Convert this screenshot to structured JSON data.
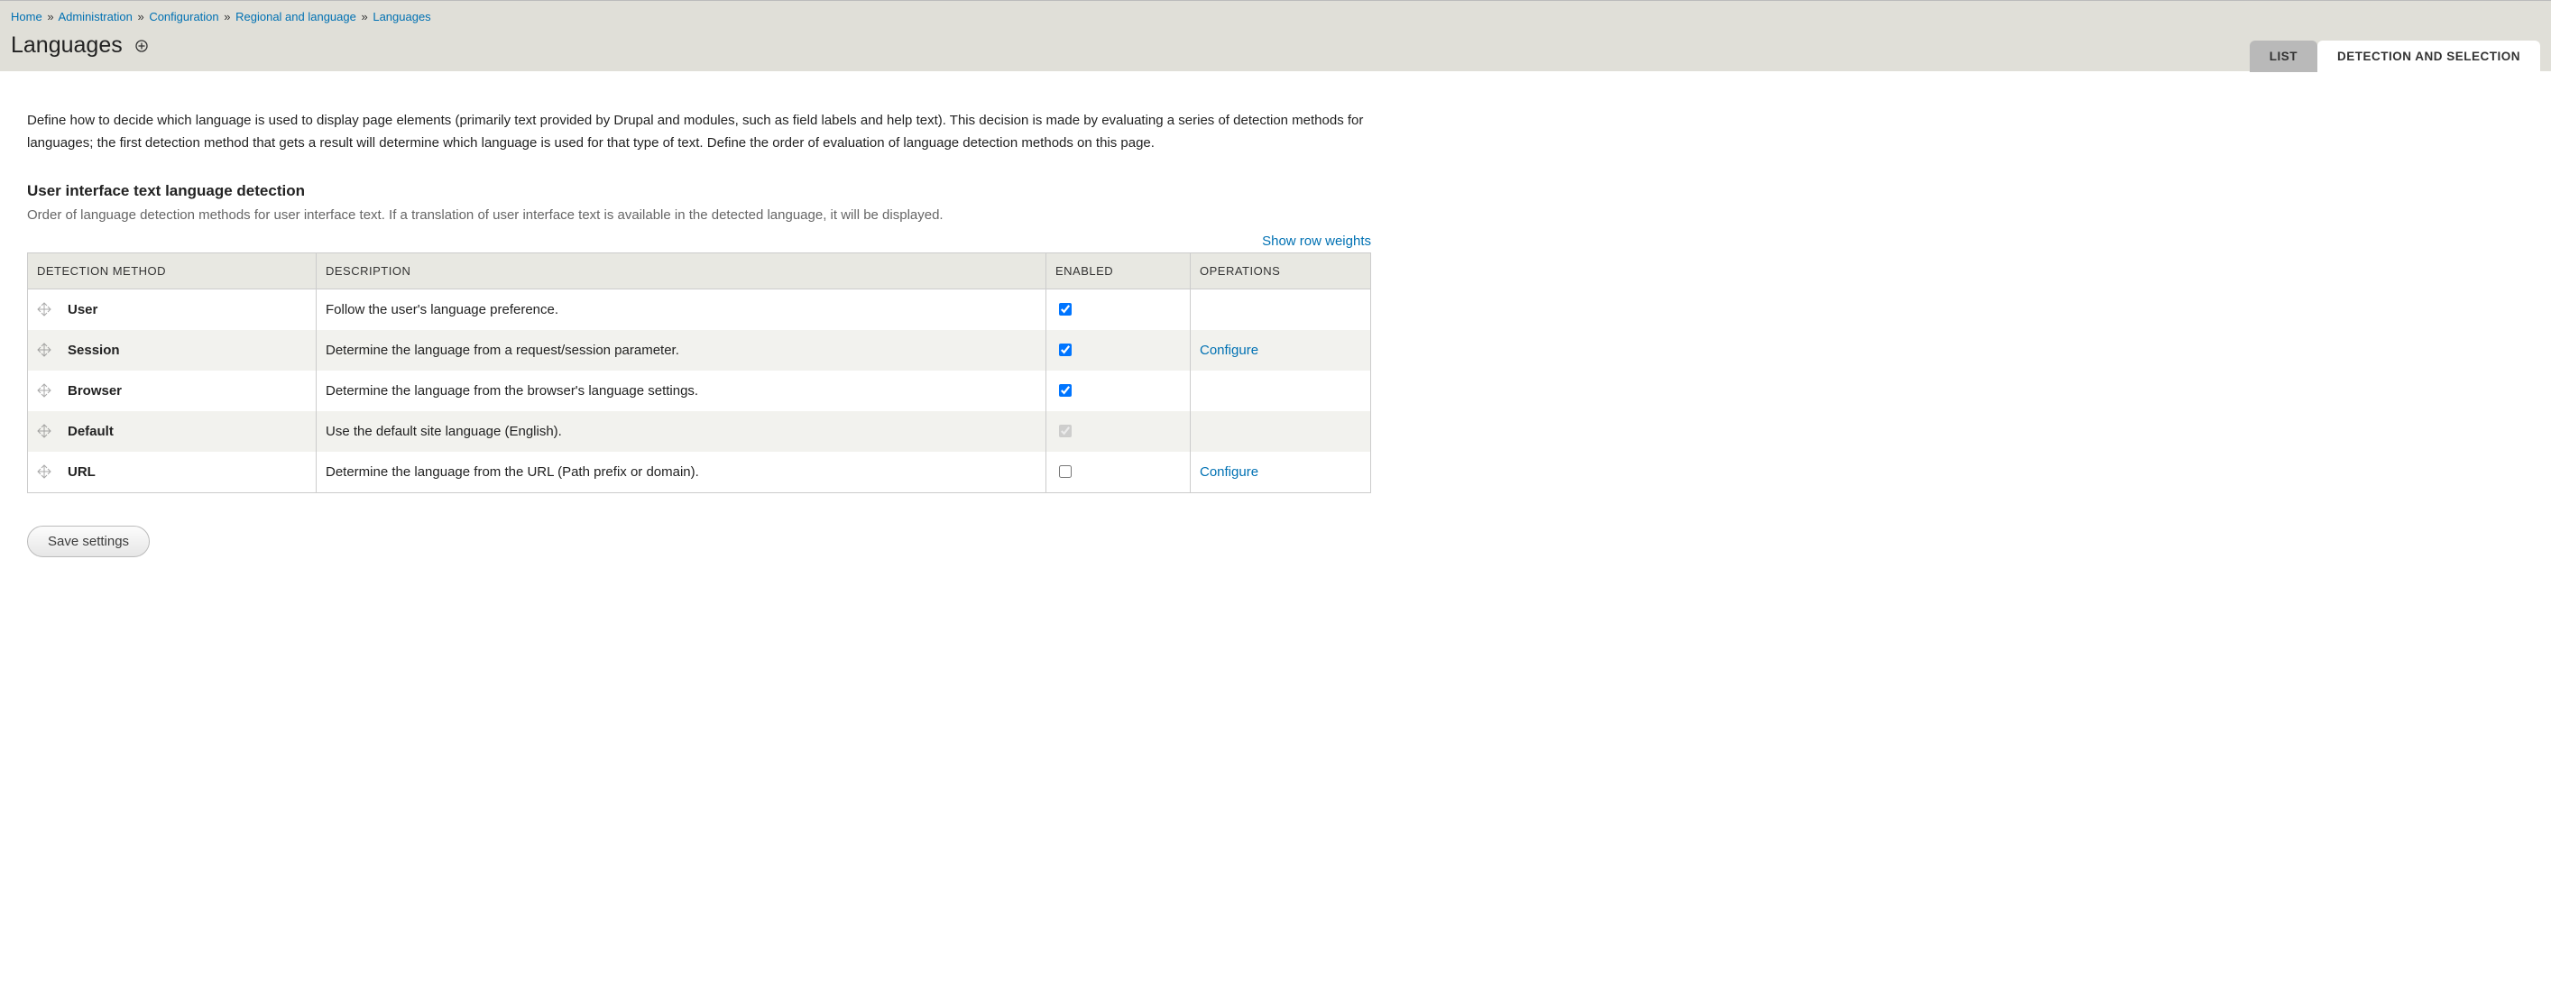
{
  "breadcrumb": [
    {
      "label": "Home"
    },
    {
      "label": "Administration"
    },
    {
      "label": "Configuration"
    },
    {
      "label": "Regional and language"
    },
    {
      "label": "Languages"
    }
  ],
  "page_title": "Languages",
  "tabs": {
    "list": "LIST",
    "detection": "DETECTION AND SELECTION"
  },
  "intro": "Define how to decide which language is used to display page elements (primarily text provided by Drupal and modules, such as field labels and help text). This decision is made by evaluating a series of detection methods for languages; the first detection method that gets a result will determine which language is used for that type of text. Define the order of evaluation of language detection methods on this page.",
  "section": {
    "title": "User interface text language detection",
    "desc": "Order of language detection methods for user interface text. If a translation of user interface text is available in the detected language, it will be displayed."
  },
  "show_weights": "Show row weights",
  "table": {
    "headers": {
      "method": "DETECTION METHOD",
      "description": "DESCRIPTION",
      "enabled": "ENABLED",
      "operations": "OPERATIONS"
    },
    "rows": [
      {
        "method": "User",
        "description": "Follow the user's language preference.",
        "enabled": true,
        "disabled": false,
        "op": ""
      },
      {
        "method": "Session",
        "description": "Determine the language from a request/session parameter.",
        "enabled": true,
        "disabled": false,
        "op": "Configure"
      },
      {
        "method": "Browser",
        "description": "Determine the language from the browser's language settings.",
        "enabled": true,
        "disabled": false,
        "op": ""
      },
      {
        "method": "Default",
        "description": "Use the default site language (English).",
        "enabled": true,
        "disabled": true,
        "op": ""
      },
      {
        "method": "URL",
        "description": "Determine the language from the URL (Path prefix or domain).",
        "enabled": false,
        "disabled": false,
        "op": "Configure"
      }
    ]
  },
  "save_label": "Save settings"
}
